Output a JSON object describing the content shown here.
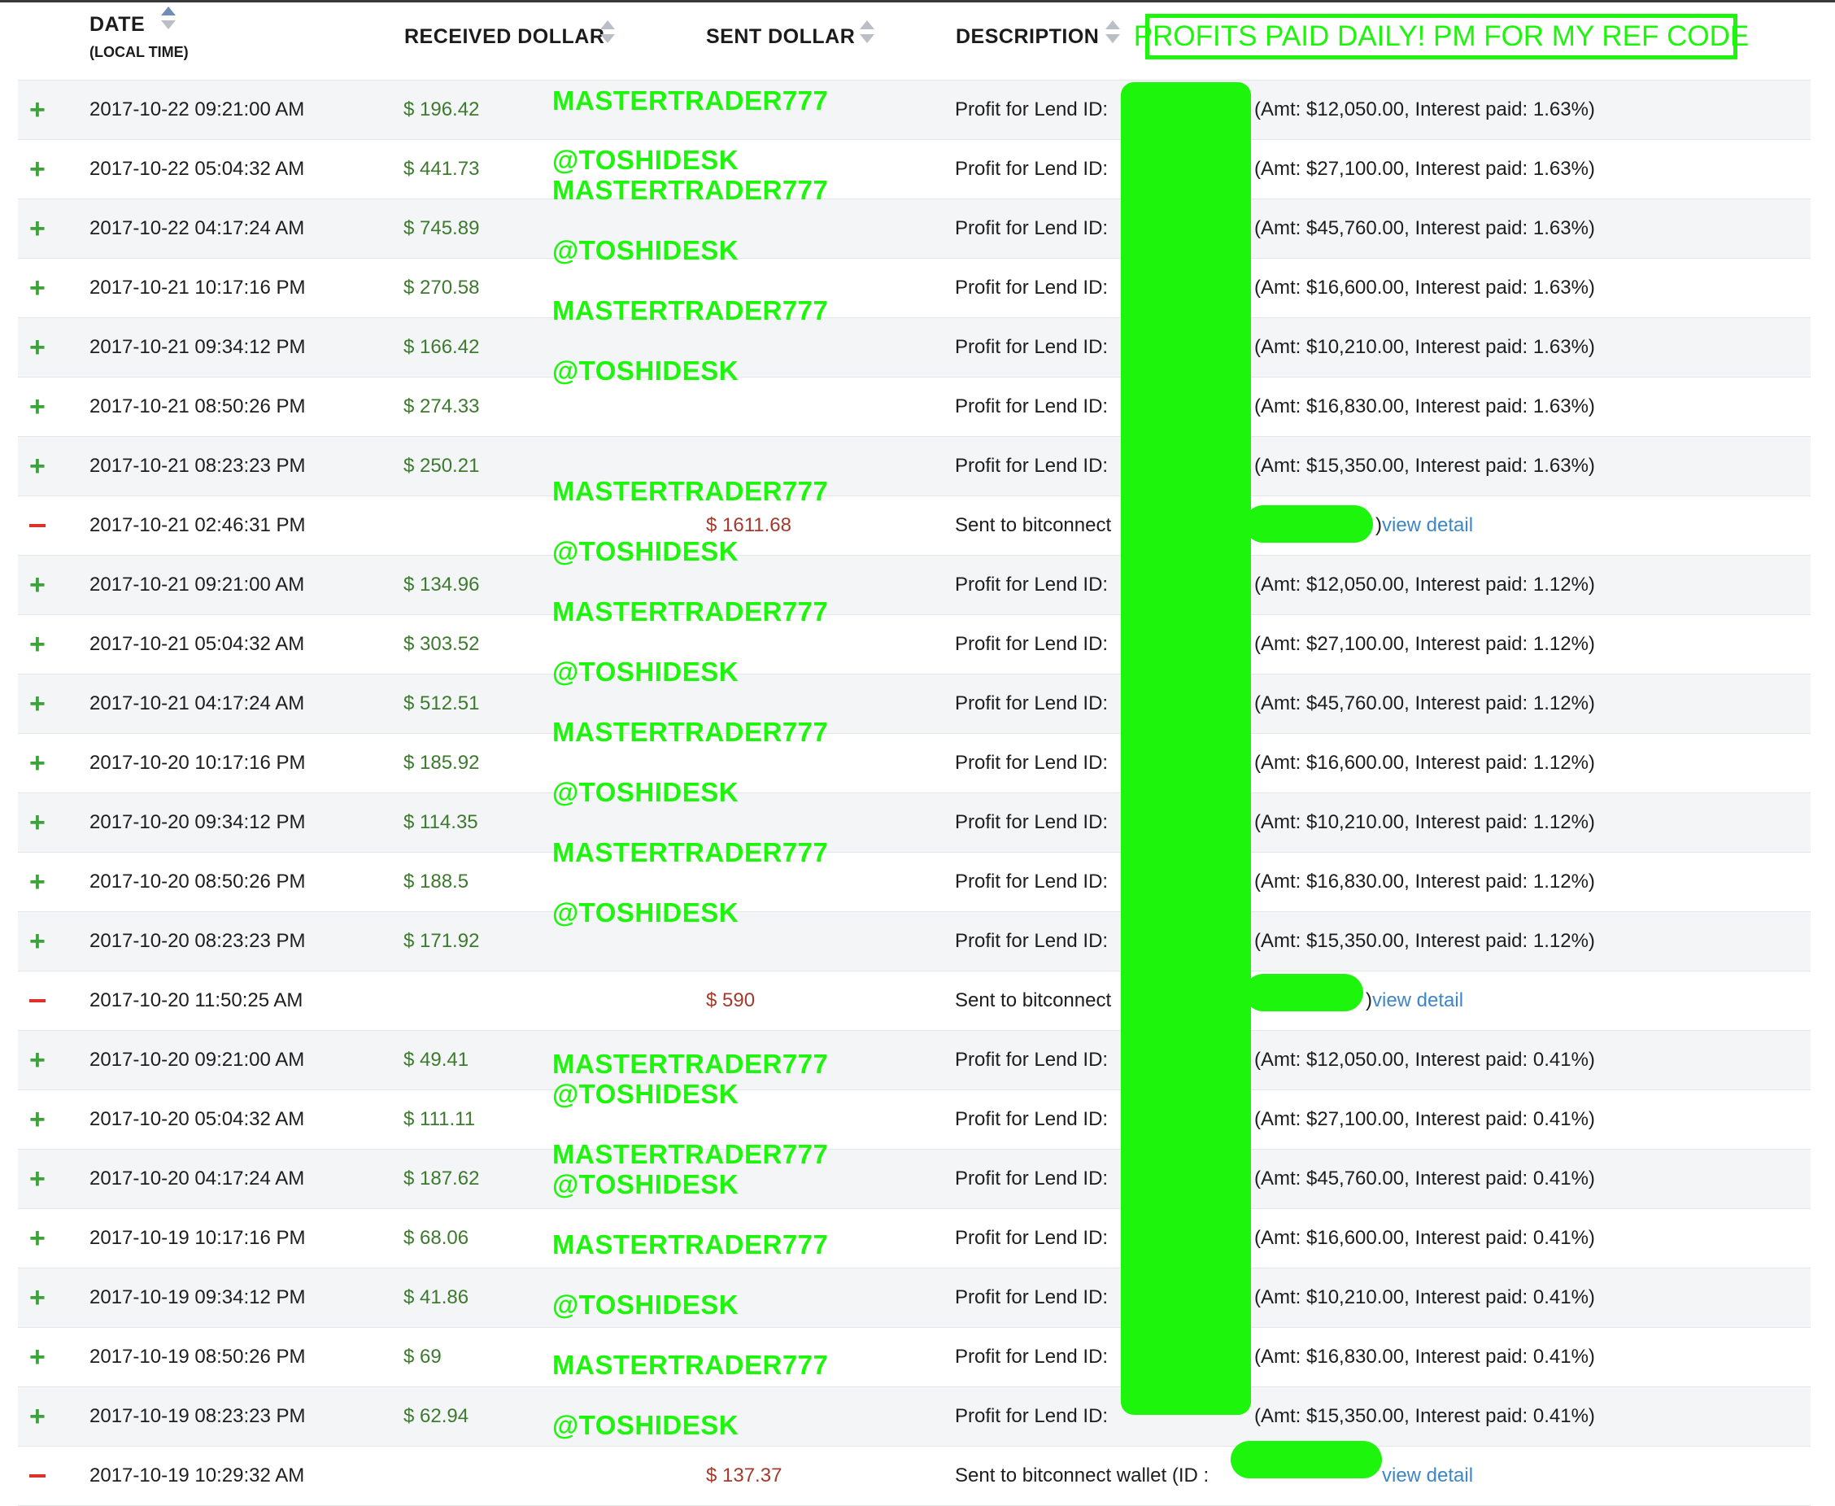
{
  "header": {
    "date_label": "DATE",
    "date_sub_label": "(LOCAL TIME)",
    "received_label": "RECEIVED DOLLAR",
    "sent_label": "SENT DOLLAR",
    "description_label": "DESCRIPTION"
  },
  "banner": "PROFITS PAID DAILY! PM FOR MY REF CODE",
  "watermarks": [
    "MASTERTRADER777",
    "@TOSHIDESK"
  ],
  "colors": {
    "highlight": "#1ef50c",
    "received": "#3d7a2f",
    "sent": "#a33a2c",
    "link": "#3f86c8",
    "plus": "#3ca33a",
    "minus": "#e0302a"
  },
  "rows": [
    {
      "sign": "+",
      "date": "2017-10-22 09:21:00 AM",
      "received": "$ 196.42",
      "sent": "",
      "description": "Profit for Lend ID:",
      "details": "(Amt: $12,050.00, Interest paid: 1.63%)"
    },
    {
      "sign": "+",
      "date": "2017-10-22 05:04:32 AM",
      "received": "$ 441.73",
      "sent": "",
      "description": "Profit for Lend ID:",
      "details": "(Amt: $27,100.00, Interest paid: 1.63%)"
    },
    {
      "sign": "+",
      "date": "2017-10-22 04:17:24 AM",
      "received": "$ 745.89",
      "sent": "",
      "description": "Profit for Lend ID:",
      "details": "(Amt: $45,760.00, Interest paid: 1.63%)"
    },
    {
      "sign": "+",
      "date": "2017-10-21 10:17:16 PM",
      "received": "$ 270.58",
      "sent": "",
      "description": "Profit for Lend ID:",
      "details": "(Amt: $16,600.00, Interest paid: 1.63%)"
    },
    {
      "sign": "+",
      "date": "2017-10-21 09:34:12 PM",
      "received": "$ 166.42",
      "sent": "",
      "description": "Profit for Lend ID:",
      "details": "(Amt: $10,210.00, Interest paid: 1.63%)"
    },
    {
      "sign": "+",
      "date": "2017-10-21 08:50:26 PM",
      "received": "$ 274.33",
      "sent": "",
      "description": "Profit for Lend ID:",
      "details": "(Amt: $16,830.00, Interest paid: 1.63%)"
    },
    {
      "sign": "+",
      "date": "2017-10-21 08:23:23 PM",
      "received": "$ 250.21",
      "sent": "",
      "description": "Profit for Lend ID:",
      "details": "(Amt: $15,350.00, Interest paid: 1.63%)"
    },
    {
      "sign": "-",
      "date": "2017-10-21 02:46:31 PM",
      "received": "",
      "sent": "$ 1611.68",
      "description": "Sent to bitconnect",
      "details": ")",
      "link": "view detail"
    },
    {
      "sign": "+",
      "date": "2017-10-21 09:21:00 AM",
      "received": "$ 134.96",
      "sent": "",
      "description": "Profit for Lend ID:",
      "details": "(Amt: $12,050.00, Interest paid: 1.12%)"
    },
    {
      "sign": "+",
      "date": "2017-10-21 05:04:32 AM",
      "received": "$ 303.52",
      "sent": "",
      "description": "Profit for Lend ID:",
      "details": "(Amt: $27,100.00, Interest paid: 1.12%)"
    },
    {
      "sign": "+",
      "date": "2017-10-21 04:17:24 AM",
      "received": "$ 512.51",
      "sent": "",
      "description": "Profit for Lend ID:",
      "details": "(Amt: $45,760.00, Interest paid: 1.12%)"
    },
    {
      "sign": "+",
      "date": "2017-10-20 10:17:16 PM",
      "received": "$ 185.92",
      "sent": "",
      "description": "Profit for Lend ID:",
      "details": "(Amt: $16,600.00, Interest paid: 1.12%)"
    },
    {
      "sign": "+",
      "date": "2017-10-20 09:34:12 PM",
      "received": "$ 114.35",
      "sent": "",
      "description": "Profit for Lend ID:",
      "details": "(Amt: $10,210.00, Interest paid: 1.12%)"
    },
    {
      "sign": "+",
      "date": "2017-10-20 08:50:26 PM",
      "received": "$ 188.5",
      "sent": "",
      "description": "Profit for Lend ID:",
      "details": "(Amt: $16,830.00, Interest paid: 1.12%)"
    },
    {
      "sign": "+",
      "date": "2017-10-20 08:23:23 PM",
      "received": "$ 171.92",
      "sent": "",
      "description": "Profit for Lend ID:",
      "details": "(Amt: $15,350.00, Interest paid: 1.12%)"
    },
    {
      "sign": "-",
      "date": "2017-10-20 11:50:25 AM",
      "received": "",
      "sent": "$ 590",
      "description": "Sent to bitconnect",
      "details": ")",
      "link": "view detail"
    },
    {
      "sign": "+",
      "date": "2017-10-20 09:21:00 AM",
      "received": "$ 49.41",
      "sent": "",
      "description": "Profit for Lend ID:",
      "details": "(Amt: $12,050.00, Interest paid: 0.41%)"
    },
    {
      "sign": "+",
      "date": "2017-10-20 05:04:32 AM",
      "received": "$ 111.11",
      "sent": "",
      "description": "Profit for Lend ID:",
      "details": "(Amt: $27,100.00, Interest paid: 0.41%)"
    },
    {
      "sign": "+",
      "date": "2017-10-20 04:17:24 AM",
      "received": "$ 187.62",
      "sent": "",
      "description": "Profit for Lend ID:",
      "details": "(Amt: $45,760.00, Interest paid: 0.41%)"
    },
    {
      "sign": "+",
      "date": "2017-10-19 10:17:16 PM",
      "received": "$ 68.06",
      "sent": "",
      "description": "Profit for Lend ID:",
      "details": "(Amt: $16,600.00, Interest paid: 0.41%)"
    },
    {
      "sign": "+",
      "date": "2017-10-19 09:34:12 PM",
      "received": "$ 41.86",
      "sent": "",
      "description": "Profit for Lend ID:",
      "details": "(Amt: $10,210.00, Interest paid: 0.41%)"
    },
    {
      "sign": "+",
      "date": "2017-10-19 08:50:26 PM",
      "received": "$ 69",
      "sent": "",
      "description": "Profit for Lend ID:",
      "details": "(Amt: $16,830.00, Interest paid: 0.41%)"
    },
    {
      "sign": "+",
      "date": "2017-10-19 08:23:23 PM",
      "received": "$ 62.94",
      "sent": "",
      "description": "Profit for Lend ID:",
      "details": "(Amt: $15,350.00, Interest paid: 0.41%)"
    },
    {
      "sign": "-",
      "date": "2017-10-19 10:29:32 AM",
      "received": "",
      "sent": "$ 137.37",
      "description": "Sent to bitconnect wallet (ID :",
      "details": "",
      "link": "view detail"
    }
  ]
}
